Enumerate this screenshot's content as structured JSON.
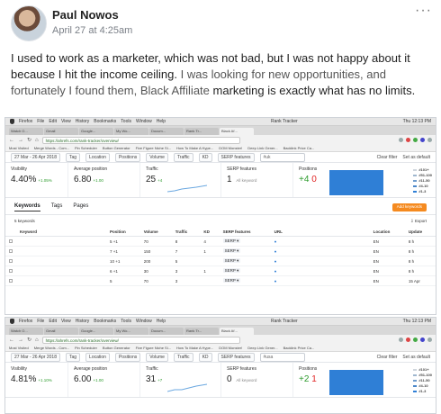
{
  "post": {
    "author": "Paul Nowos",
    "date": "April 27 at 4:25am",
    "more": "···",
    "text_1": "I used to work as a marketer, which was not bad, but I was not happy about it because I hit the income ceiling.",
    "text_2": " I was looking for new opportunities, and fortunately I found them, ",
    "text_3": "Black Affiliate",
    "text_4": " marketing is exactly what has no limits."
  },
  "screens": [
    {
      "menu": [
        "Firefox",
        "File",
        "Edit",
        "View",
        "History",
        "Bookmarks",
        "Tools",
        "Window",
        "Help"
      ],
      "clock": "Thu 12:13 PM",
      "window_title": "Rank Tracker",
      "tabs": [
        "Watch O...",
        "Gmail",
        "Google...",
        "My Wo...",
        "Docum...",
        "Rank Tr...",
        "Black Af..."
      ],
      "url": "https://ahrefs.com/rank-tracker/overview/",
      "bookmarks": [
        "Most Visited",
        "Merge Words - Com...",
        "Pin Scheduler",
        "Button Generator",
        "Five Figure Niche Si...",
        "How To Make A Hype...",
        "DOM Monster!",
        "Deep Link Gener...",
        "Backlink Price Ca..."
      ],
      "date_range": "27 Mar - 26 Apr 2018",
      "filters": [
        "Tag",
        "Location",
        "Positions",
        "Volume",
        "Traffic",
        "KD",
        "SERP features"
      ],
      "search_value": "#uk",
      "clear_filter": "Clear filter",
      "set_default": "Set as default",
      "metrics": {
        "visibility": {
          "label": "Visibility",
          "value": "4.40%",
          "change": "+1.05%"
        },
        "avg_position": {
          "label": "Average position",
          "value": "6.80",
          "change": "+1.00"
        },
        "traffic": {
          "label": "Traffic",
          "value": "25",
          "change": "+4"
        },
        "serp": {
          "label": "SERP features",
          "value": "1",
          "note": "All keyword"
        },
        "positions": {
          "label": "Positions",
          "up": "+4",
          "down": "0"
        }
      },
      "legend": [
        "#101+",
        "#51-100",
        "#11-50",
        "#4-10",
        "#1-3"
      ],
      "subtabs": [
        "Keywords",
        "Tags",
        "Pages"
      ],
      "add_keywords": "Add keywords",
      "keyword_count": "5 keywords",
      "export": "Export",
      "columns": [
        "Keyword",
        "Position",
        "Volume",
        "Traffic",
        "KD",
        "SERP features",
        "URL",
        "Location",
        "Update"
      ],
      "rows": [
        {
          "pos": "5 +1",
          "vol": "70",
          "traffic": "8",
          "kd": "4",
          "loc": "EN",
          "upd": "8 h"
        },
        {
          "pos": "7 +1",
          "vol": "150",
          "traffic": "7",
          "kd": "1",
          "loc": "EN",
          "upd": "8 h"
        },
        {
          "pos": "10 +1",
          "vol": "200",
          "traffic": "5",
          "kd": "",
          "loc": "EN",
          "upd": "8 h"
        },
        {
          "pos": "6 +1",
          "vol": "30",
          "traffic": "3",
          "kd": "1",
          "loc": "EN",
          "upd": "8 h"
        },
        {
          "pos": "5",
          "vol": "70",
          "traffic": "3",
          "kd": "",
          "loc": "EN",
          "upd": "15 Apr"
        }
      ]
    },
    {
      "clock": "Thu 12:13 PM",
      "date_range": "27 Mar - 26 Apr 2018",
      "search_value": "#usa",
      "metrics": {
        "visibility": {
          "label": "Visibility",
          "value": "4.81%",
          "change": "+1.10%"
        },
        "avg_position": {
          "label": "Average position",
          "value": "6.00",
          "change": "+1.00"
        },
        "traffic": {
          "label": "Traffic",
          "value": "31",
          "change": "+7"
        },
        "serp": {
          "label": "SERP features",
          "value": "0",
          "note": "All keyword"
        },
        "positions": {
          "label": "Positions",
          "up": "+2",
          "down": "1"
        }
      }
    }
  ],
  "colors": {
    "accent_orange": "#f58a1f",
    "blue_bar": "#2f7fd6",
    "green": "#2c9b2c",
    "red": "#e02424"
  }
}
